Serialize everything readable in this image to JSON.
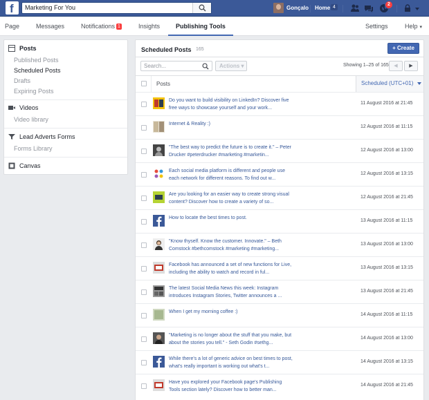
{
  "colors": {
    "brand": "#3b5998",
    "accent": "#4267b2",
    "badge": "#fa3e3e",
    "link": "#365899"
  },
  "topbar": {
    "logo_letter": "f",
    "search_value": "Marketing For You",
    "user_name": "Gonçalo",
    "home_label": "Home",
    "home_count": "4",
    "notifications_count": "2"
  },
  "tabs": [
    {
      "label": "Page"
    },
    {
      "label": "Messages"
    },
    {
      "label": "Notifications",
      "badge": "1"
    },
    {
      "label": "Insights"
    },
    {
      "label": "Publishing Tools",
      "active": true
    },
    {
      "label": "Settings"
    },
    {
      "label": "Help"
    }
  ],
  "sidebar": {
    "posts": "Posts",
    "published": "Published Posts",
    "scheduled": "Scheduled Posts",
    "drafts": "Drafts",
    "expiring": "Expiring Posts",
    "videos": "Videos",
    "video_library": "Video library",
    "lead_ads": "Lead Adverts Forms",
    "forms_library": "Forms Library",
    "canvas": "Canvas"
  },
  "main": {
    "title": "Scheduled Posts",
    "count": "165",
    "create_label": "+ Create",
    "search_placeholder": "Search...",
    "actions_label": "Actions ▾",
    "showing": "Showing 1–25 of 165",
    "prev": "◀",
    "next": "▶",
    "col_posts": "Posts",
    "col_scheduled": "Scheduled (UTC+01)"
  },
  "rows": [
    {
      "text": "Do you want to build visibility on LinkedIn? Discover five free ways to showcase yourself and your work...",
      "date": "11 August 2016 at 21:45",
      "thumb": "book-yellow"
    },
    {
      "text": "Internet & Reality :)",
      "date": "12 August 2016 at 11:15",
      "thumb": "comic"
    },
    {
      "text": "\"The best way to predict the future is to create it.\" – Peter Drucker #peterdrucker #marketing #marketin...",
      "date": "12 August 2016 at 13:00",
      "thumb": "portrait-dark"
    },
    {
      "text": "Each social media platform is different and people use each network for different reasons. To find out w...",
      "date": "12 August 2016 at 13:15",
      "thumb": "social-icons"
    },
    {
      "text": "Are you looking for an easier way to create strong visual content? Discover how to create a variety of so...",
      "date": "12 August 2016 at 21:45",
      "thumb": "book-green"
    },
    {
      "text": "How to locate the best times to post.",
      "date": "13 August 2016 at 11:15",
      "thumb": "facebook"
    },
    {
      "text": "\"Know thyself. Know the customer. Innovate.\" – Beth Comstock #bethcomstock #marketing #marketing...",
      "date": "13 August 2016 at 13:00",
      "thumb": "portrait-woman"
    },
    {
      "text": "Facebook has announced a set of new functions for Live, including the ability to watch and record in ful...",
      "date": "13 August 2016 at 13:15",
      "thumb": "screen-red"
    },
    {
      "text": "The latest Social Media News this week: Instagram introduces Instagram Stories, Twitter announces a ...",
      "date": "13 August 2016 at 21:45",
      "thumb": "news"
    },
    {
      "text": "When I get my morning coffee :)",
      "date": "14 August 2016 at 11:15",
      "thumb": "comic-green"
    },
    {
      "text": "\"Marketing is no longer about the stuff that you make, but about the stories you tell.\" - Seth Godin #sethg...",
      "date": "14 August 2016 at 13:00",
      "thumb": "portrait-man"
    },
    {
      "text": "While there's a lot of generic advice on best times to post, what's really important is working out what's t...",
      "date": "14 August 2016 at 13:15",
      "thumb": "facebook"
    },
    {
      "text": "Have you explored your Facebook page's Publishing Tools section lately? Discover how to better man...",
      "date": "14 August 2016 at 21:45",
      "thumb": "screen-red"
    }
  ]
}
